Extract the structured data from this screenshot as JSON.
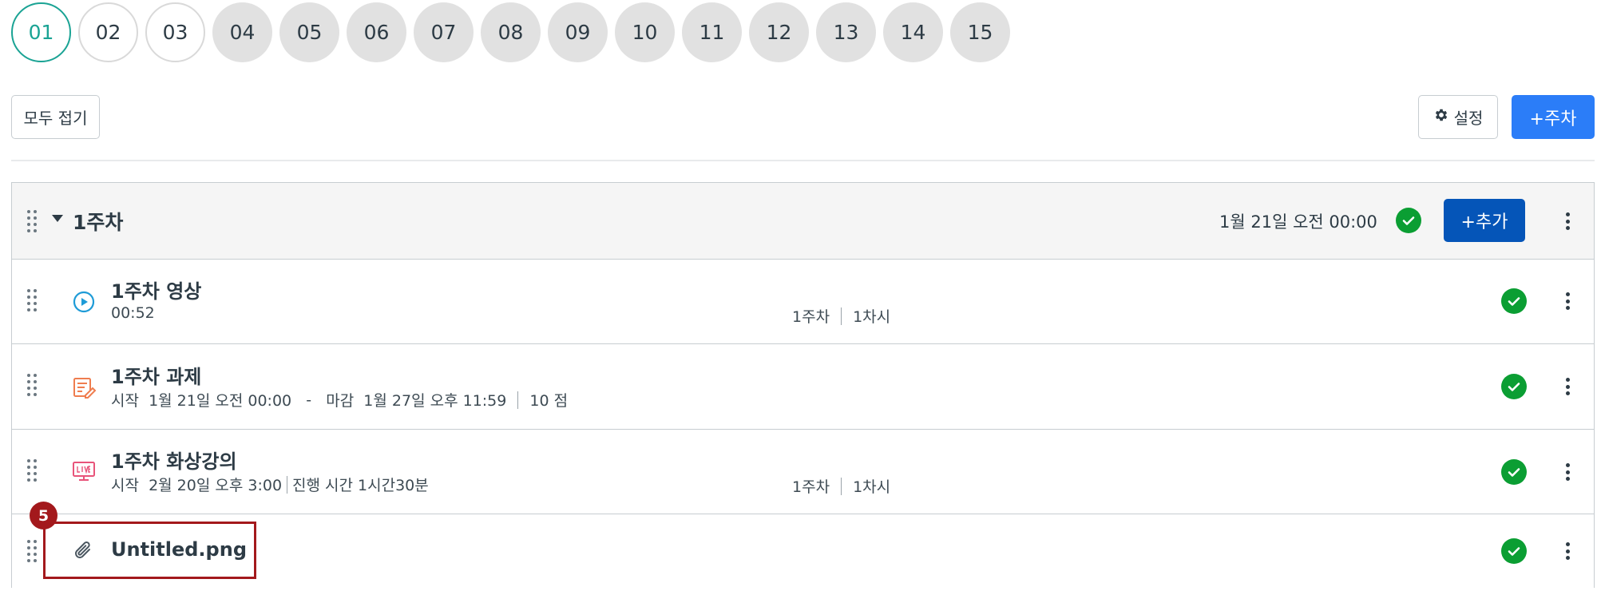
{
  "weeks": [
    {
      "label": "01",
      "state": "active"
    },
    {
      "label": "02",
      "state": "open"
    },
    {
      "label": "03",
      "state": "open"
    },
    {
      "label": "04",
      "state": "closed"
    },
    {
      "label": "05",
      "state": "closed"
    },
    {
      "label": "06",
      "state": "closed"
    },
    {
      "label": "07",
      "state": "closed"
    },
    {
      "label": "08",
      "state": "closed"
    },
    {
      "label": "09",
      "state": "closed"
    },
    {
      "label": "10",
      "state": "closed"
    },
    {
      "label": "11",
      "state": "closed"
    },
    {
      "label": "12",
      "state": "closed"
    },
    {
      "label": "13",
      "state": "closed"
    },
    {
      "label": "14",
      "state": "closed"
    },
    {
      "label": "15",
      "state": "closed"
    }
  ],
  "toolbar": {
    "collapse_all": "모두 접기",
    "settings": "설정",
    "add_week": "+주차"
  },
  "module": {
    "title": "1주차",
    "date": "1월 21일 오전 00:00",
    "add_item": "+추가"
  },
  "items": {
    "video": {
      "title": "1주차 영상",
      "duration": "00:52",
      "week": "1주차",
      "session": "1차시",
      "icon": "play-circle-icon"
    },
    "assignment": {
      "title": "1주차 과제",
      "start_label": "시작",
      "start": "1월 21일 오전 00:00",
      "dash": "-",
      "due_label": "마감",
      "due": "1월 27일 오후 11:59",
      "points": "10 점",
      "icon": "assignment-edit-icon"
    },
    "live": {
      "title": "1주차 화상강의",
      "start_label": "시작",
      "start": "2월 20일 오후 3:00",
      "duration": "진행 시간 1시간30분",
      "week": "1주차",
      "session": "1차시",
      "icon": "live-monitor-icon"
    },
    "file": {
      "title": "Untitled.png",
      "icon": "paperclip-icon"
    }
  },
  "annotation": {
    "badge": "5"
  },
  "colors": {
    "accent_teal": "#1aa394",
    "primary_blue": "#2b7df8",
    "dark_blue": "#0555b8",
    "success_green": "#0b9e33",
    "annotation_red": "#a3191c"
  }
}
